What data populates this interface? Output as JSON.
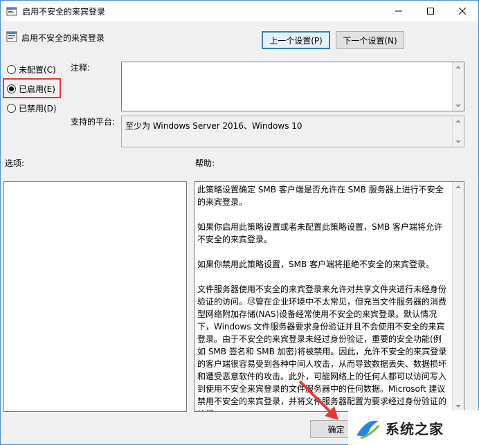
{
  "window": {
    "title": "启用不安全的来宾登录"
  },
  "policy": {
    "name": "启用不安全的来宾登录"
  },
  "nav": {
    "prev_label": "上一个设置(P)",
    "next_label": "下一个设置(N)"
  },
  "state": {
    "options": [
      {
        "label": "未配置(C)",
        "checked": false
      },
      {
        "label": "已启用(E)",
        "checked": true
      },
      {
        "label": "已禁用(D)",
        "checked": false
      }
    ]
  },
  "comment": {
    "label": "注释:",
    "value": ""
  },
  "platform": {
    "label": "支持的平台:",
    "value": "至少为 Windows Server 2016、Windows 10"
  },
  "options_section": {
    "label": "选项:"
  },
  "help_section": {
    "label": "帮助:",
    "paragraphs": [
      "此策略设置确定 SMB 客户端是否允许在 SMB 服务器上进行不安全的来宾登录。",
      "如果你启用此策略设置或者未配置此策略设置，SMB 客户端将允许不安全的来宾登录。",
      "如果你禁用此策略设置，SMB 客户端将拒绝不安全的来宾登录。",
      "文件服务器使用不安全的来宾登录来允许对共享文件夹进行未经身份验证的访问。尽管在企业环境中不太常见，但充当文件服务器的消费型网络附加存储(NAS)设备经常使用不安全的来宾登录。默认情况下，Windows 文件服务器要求身份验证并且不会使用不安全的来宾登录。由于不安全的来宾登录未经过身份验证，重要的安全功能(例如 SMB 签名和 SMB 加密)将被禁用。因此，允许不安全的来宾登录的客户端很容易受到各种中间人攻击，从而导致数据丢失、数据损坏和遭受恶意软件的攻击。此外，可能网络上的任何人都可以访问写入到使用不安全来宾登录的文件服务器中的任何数据。Microsoft 建议禁用不安全的来宾登录，并将文件服务器配置为要求经过身份验证的访问。"
    ]
  },
  "footer": {
    "ok_label": "确定"
  },
  "watermark": {
    "text": "系统之家"
  },
  "colors": {
    "highlight": "#e53935",
    "arrow": "#e53935",
    "titlebar_border": "#4a90d9"
  }
}
